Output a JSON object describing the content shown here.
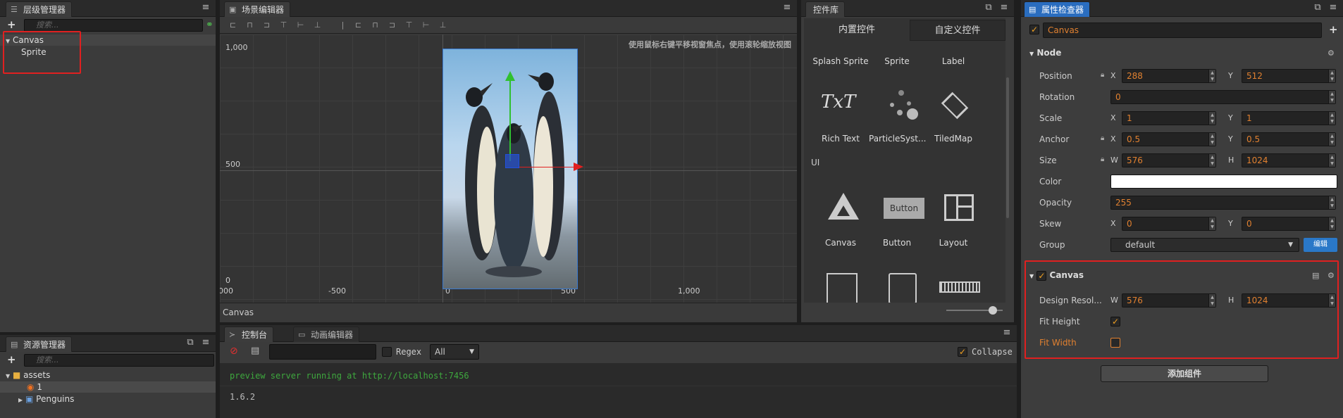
{
  "hierarchy": {
    "tab_label": "层级管理器",
    "search_placeholder": "搜索...",
    "items": [
      "Canvas",
      "Sprite"
    ]
  },
  "assets": {
    "tab_label": "资源管理器",
    "search_placeholder": "搜索...",
    "items": [
      "assets",
      "1",
      "Penguins"
    ]
  },
  "scene": {
    "tab_label": "场景编辑器",
    "hint": "使用鼠标右键平移视窗焦点，使用滚轮缩放视图",
    "y_ticks": [
      "1,000",
      "500",
      "0"
    ],
    "x_ticks": [
      "000",
      "-500",
      "0",
      "500",
      "1,000"
    ],
    "status": "Canvas"
  },
  "console": {
    "tab_label": "控制台",
    "anim_tab_label": "动画编辑器",
    "regex_label": "Regex",
    "filter_value": "All",
    "collapse_label": "Collapse",
    "lines": [
      "preview server running at http://localhost:7456",
      "1.6.2"
    ]
  },
  "library": {
    "tab_label": "控件库",
    "tab_builtin": "内置控件",
    "tab_custom": "自定义控件",
    "top_row": [
      "Splash Sprite",
      "Sprite",
      "Label"
    ],
    "row2": [
      "Rich Text",
      "ParticleSyst...",
      "TiledMap"
    ],
    "rich_text_glyph": "TxT",
    "section_ui": "UI",
    "row3": [
      "Canvas",
      "Button",
      "Layout"
    ],
    "button_glyph": "Button"
  },
  "inspector": {
    "tab_label": "属性检查器",
    "node_name": "Canvas",
    "node_section": "Node",
    "position": {
      "label": "Position",
      "x": "288",
      "y": "512"
    },
    "rotation": {
      "label": "Rotation",
      "value": "0"
    },
    "scale": {
      "label": "Scale",
      "x": "1",
      "y": "1"
    },
    "anchor": {
      "label": "Anchor",
      "x": "0.5",
      "y": "0.5"
    },
    "size": {
      "label": "Size",
      "w": "576",
      "h": "1024"
    },
    "color": {
      "label": "Color",
      "value": "#ffffff"
    },
    "opacity": {
      "label": "Opacity",
      "value": "255"
    },
    "skew": {
      "label": "Skew",
      "x": "0",
      "y": "0"
    },
    "group": {
      "label": "Group",
      "value": "default",
      "edit_label": "编辑"
    },
    "canvas_section": "Canvas",
    "design_resolution": {
      "label": "Design Resol...",
      "w": "576",
      "h": "1024"
    },
    "fit_height": {
      "label": "Fit Height",
      "checked": true
    },
    "fit_width": {
      "label": "Fit Width",
      "checked": false
    },
    "add_component_label": "添加组件",
    "axis_x": "X",
    "axis_y": "Y",
    "axis_w": "W",
    "axis_h": "H"
  }
}
